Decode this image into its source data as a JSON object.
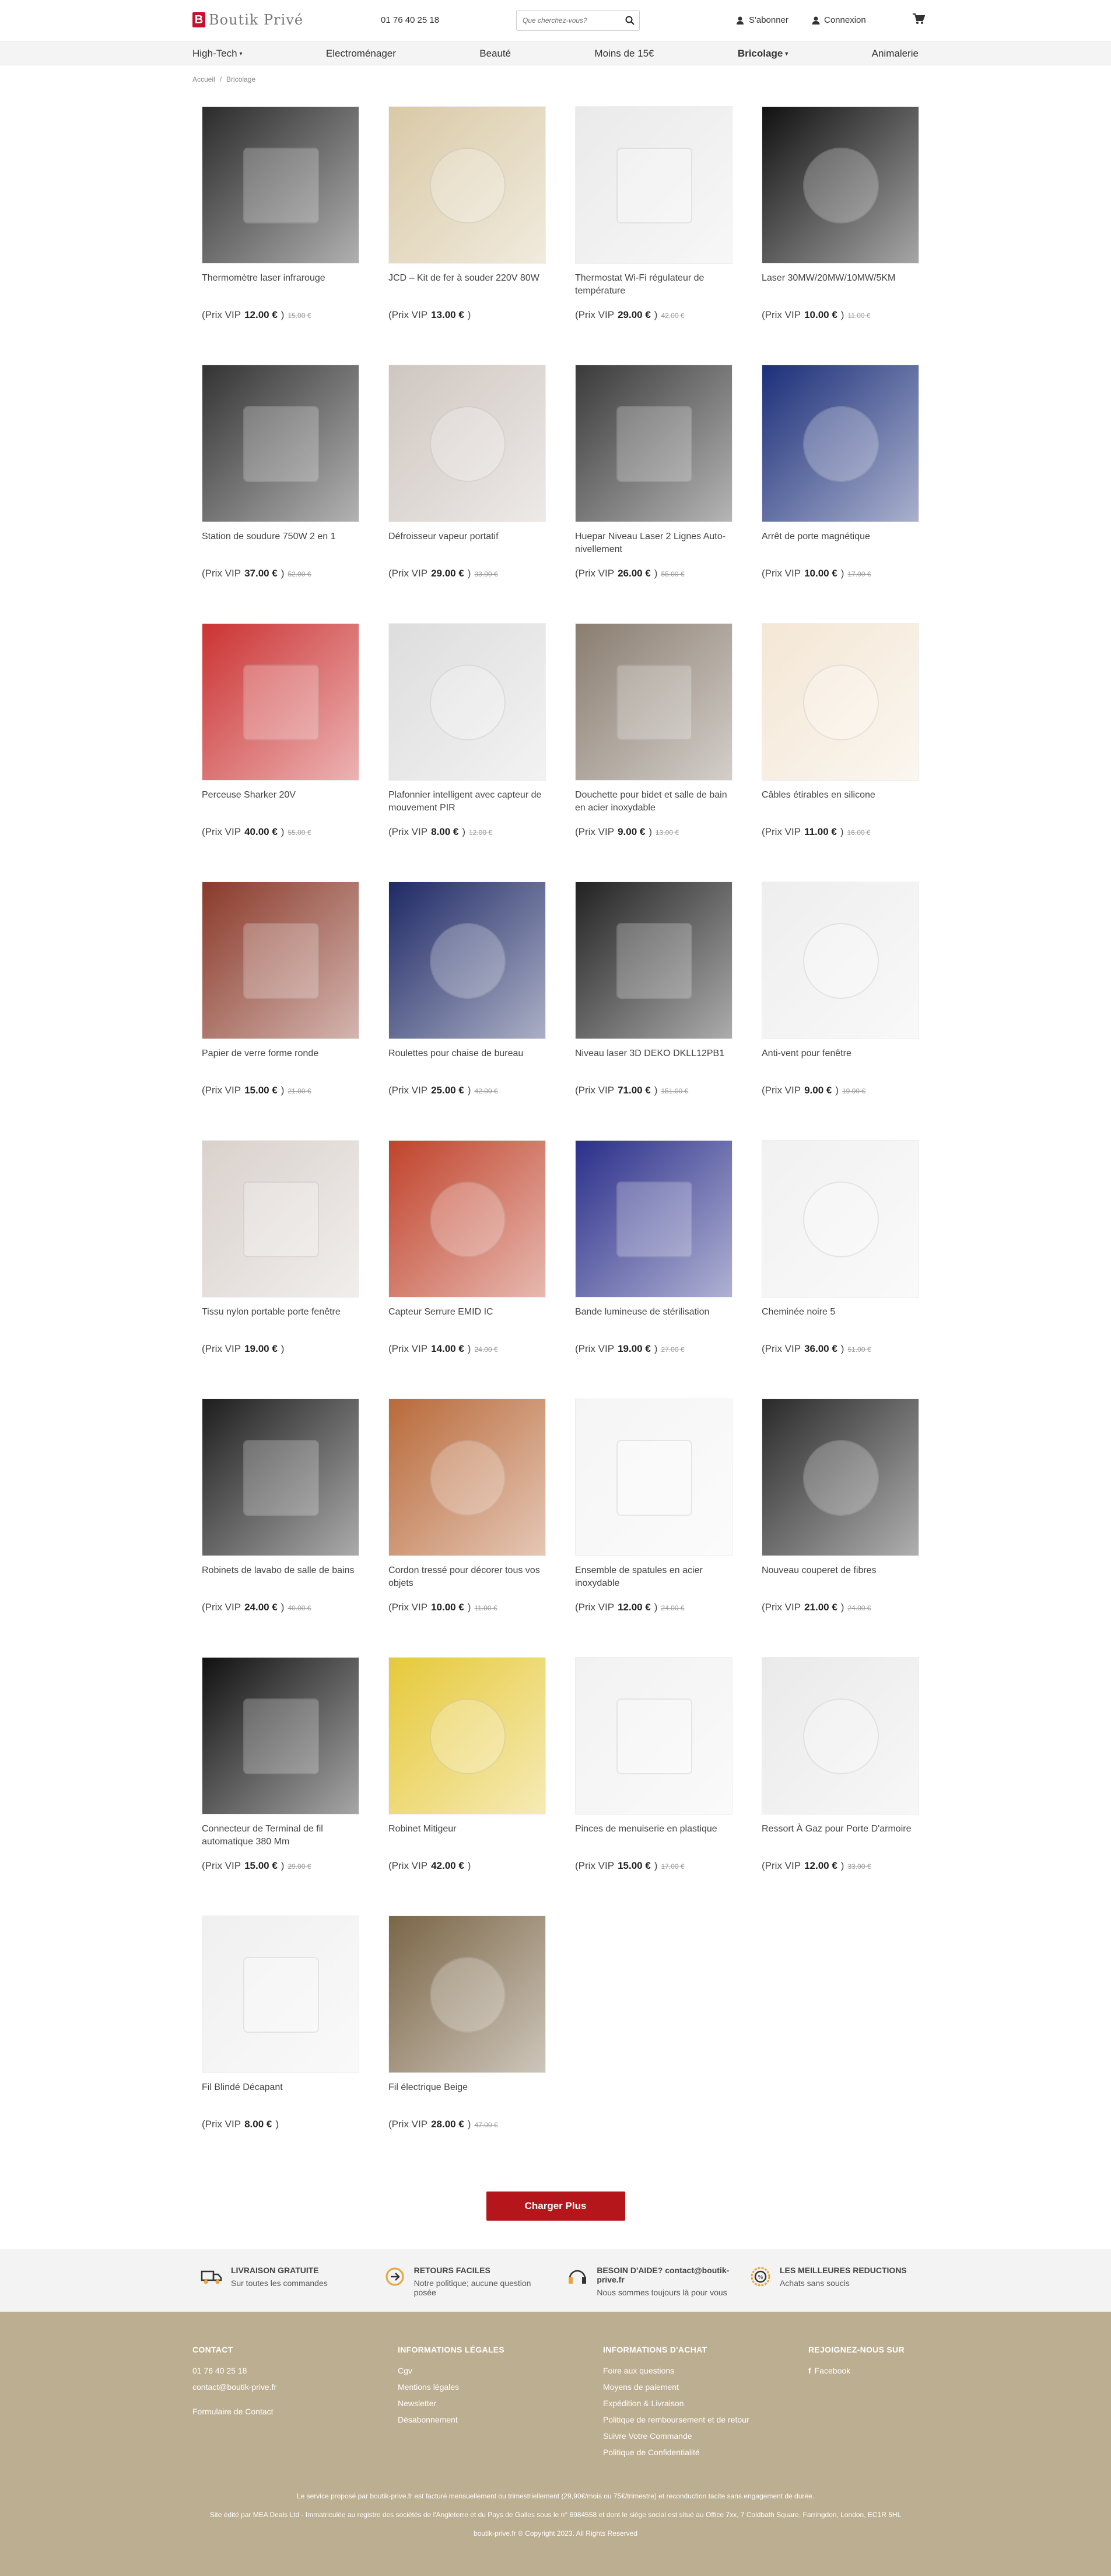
{
  "header": {
    "logo_letter": "B",
    "logo_text": "Boutik Privé",
    "phone": "01 76 40 25 18",
    "search_placeholder": "Que cherchez-vous?",
    "subscribe": "S'abonner",
    "login": "Connexion"
  },
  "nav": [
    "High-Tech",
    "Electroménager",
    "Beauté",
    "Moins de 15€",
    "Bricolage",
    "Animalerie"
  ],
  "breadcrumb": [
    "Accueil",
    "Bricolage"
  ],
  "price_prefix": "(Prix VIP",
  "products": [
    {
      "name": "Thermomètre laser infrarouge",
      "price": "12.00 €",
      "old": "15.00 €"
    },
    {
      "name": "JCD – Kit de fer à souder 220V 80W",
      "price": "13.00 €",
      "old": ""
    },
    {
      "name": "Thermostat Wi-Fi régulateur de température",
      "price": "29.00 €",
      "old": "42.00 €"
    },
    {
      "name": "Laser 30MW/20MW/10MW/5KM",
      "price": "10.00 €",
      "old": "11.00 €"
    },
    {
      "name": "Station de soudure 750W 2 en 1",
      "price": "37.00 €",
      "old": "52.00 €"
    },
    {
      "name": "Défroisseur vapeur portatif",
      "price": "29.00 €",
      "old": "33.00 €"
    },
    {
      "name": "Huepar Niveau Laser 2 Lignes Auto-nivellement",
      "price": "26.00 €",
      "old": "55.00 €"
    },
    {
      "name": "Arrêt de porte magnétique",
      "price": "10.00 €",
      "old": "17.00 €"
    },
    {
      "name": "Perceuse Sharker 20V",
      "price": "40.00 €",
      "old": "55.00 €"
    },
    {
      "name": "Plafonnier intelligent avec capteur de mouvement PIR",
      "price": "8.00 €",
      "old": "12.00 €"
    },
    {
      "name": "Douchette pour bidet et salle de bain en acier inoxydable",
      "price": "9.00 €",
      "old": "13.00 €"
    },
    {
      "name": "Câbles étirables en silicone",
      "price": "11.00 €",
      "old": "16.00 €"
    },
    {
      "name": "Papier de verre forme ronde",
      "price": "15.00 €",
      "old": "21.00 €"
    },
    {
      "name": "Roulettes pour chaise de bureau",
      "price": "25.00 €",
      "old": "42.00 €"
    },
    {
      "name": "Niveau laser 3D DEKO DKLL12PB1",
      "price": "71.00 €",
      "old": "151.00 €"
    },
    {
      "name": "Anti-vent pour fenêtre",
      "price": "9.00 €",
      "old": "19.00 €"
    },
    {
      "name": "Tissu nylon portable porte fenêtre",
      "price": "19.00 €",
      "old": ""
    },
    {
      "name": "Capteur Serrure EMID IC",
      "price": "14.00 €",
      "old": "24.00 €"
    },
    {
      "name": "Bande lumineuse de stérilisation",
      "price": "19.00 €",
      "old": "27.00 €"
    },
    {
      "name": "Cheminée noire 5",
      "price": "36.00 €",
      "old": "51.00 €"
    },
    {
      "name": "Robinets de lavabo de salle de bains",
      "price": "24.00 €",
      "old": "40.00 €"
    },
    {
      "name": "Cordon tressé pour décorer tous vos objets",
      "price": "10.00 €",
      "old": "11.00 €"
    },
    {
      "name": "Ensemble de spatules en acier inoxydable",
      "price": "12.00 €",
      "old": "24.00 €"
    },
    {
      "name": "Nouveau coupe­ret de fibres",
      "price": "21.00 €",
      "old": "24.00 €"
    },
    {
      "name": "Connecteur de Terminal de fil automatique 380 Mm",
      "price": "15.00 €",
      "old": "29.00 €"
    },
    {
      "name": "Robinet Mitigeur",
      "price": "42.00 €",
      "old": ""
    },
    {
      "name": "Pinces de menuiserie en plastique",
      "price": "15.00 €",
      "old": "17.00 €"
    },
    {
      "name": "Ressort À Gaz pour Porte D'armoire",
      "price": "12.00 €",
      "old": "33.00 €"
    },
    {
      "name": "Fil Blindé Décapant",
      "price": "8.00 €",
      "old": ""
    },
    {
      "name": "Fil électrique Beige",
      "price": "28.00 €",
      "old": "47.00 €"
    }
  ],
  "load_more": "Charger Plus",
  "features": [
    {
      "title": "LIVRAISON GRATUITE",
      "text": "Sur toutes les commandes"
    },
    {
      "title": "RETOURS FACILES",
      "text": "Notre politique; aucune question posée"
    },
    {
      "title": "BESOIN D'AIDE? contact@boutik-prive.fr",
      "text": "Nous sommes toujours là pour vous"
    },
    {
      "title": "LES MEILLEURES REDUCTIONS",
      "text": "Achats sans soucis"
    }
  ],
  "footer": {
    "contact_title": "CONTACT",
    "contact_lines": [
      "01 76 40 25 18",
      "contact@boutik-prive.fr",
      "",
      "Formulaire de Contact"
    ],
    "legal_title": "INFORMATIONS LÉGALES",
    "legal_lines": [
      "Cgv",
      "Mentions légales",
      "Newsletter",
      "Désabonnement"
    ],
    "buy_title": "INFORMATIONS D'ACHAT",
    "buy_lines": [
      "Foire aux questions",
      "Moyens de paiement",
      "Expédition & Livraison",
      "Politique de remboursement et de retour",
      "Suivre Votre Commande",
      "Politique de Confidentialité"
    ],
    "join_title": "REJOIGNEZ-NOUS SUR",
    "facebook": "Facebook",
    "notice1": "Le service proposé par boutik-prive.fr est facturé mensuellement ou trimestriellement (29,90€/mois ou 75€/trimestre) et reconduction tacite sans engagement de durée.",
    "notice2": "Site édité par MEA Deals Ltd - Immatriculée au registre des sociétés de l'Angleterre et du Pays de Galles sous le n° 6984558 et dont le siège social est situé au Office 7xx, 7 Coldbath Square, Farringdon, London, EC1R 5HL",
    "copyright": "boutik-prive.fr ® Copyright 2023. All Rights Reserved"
  }
}
